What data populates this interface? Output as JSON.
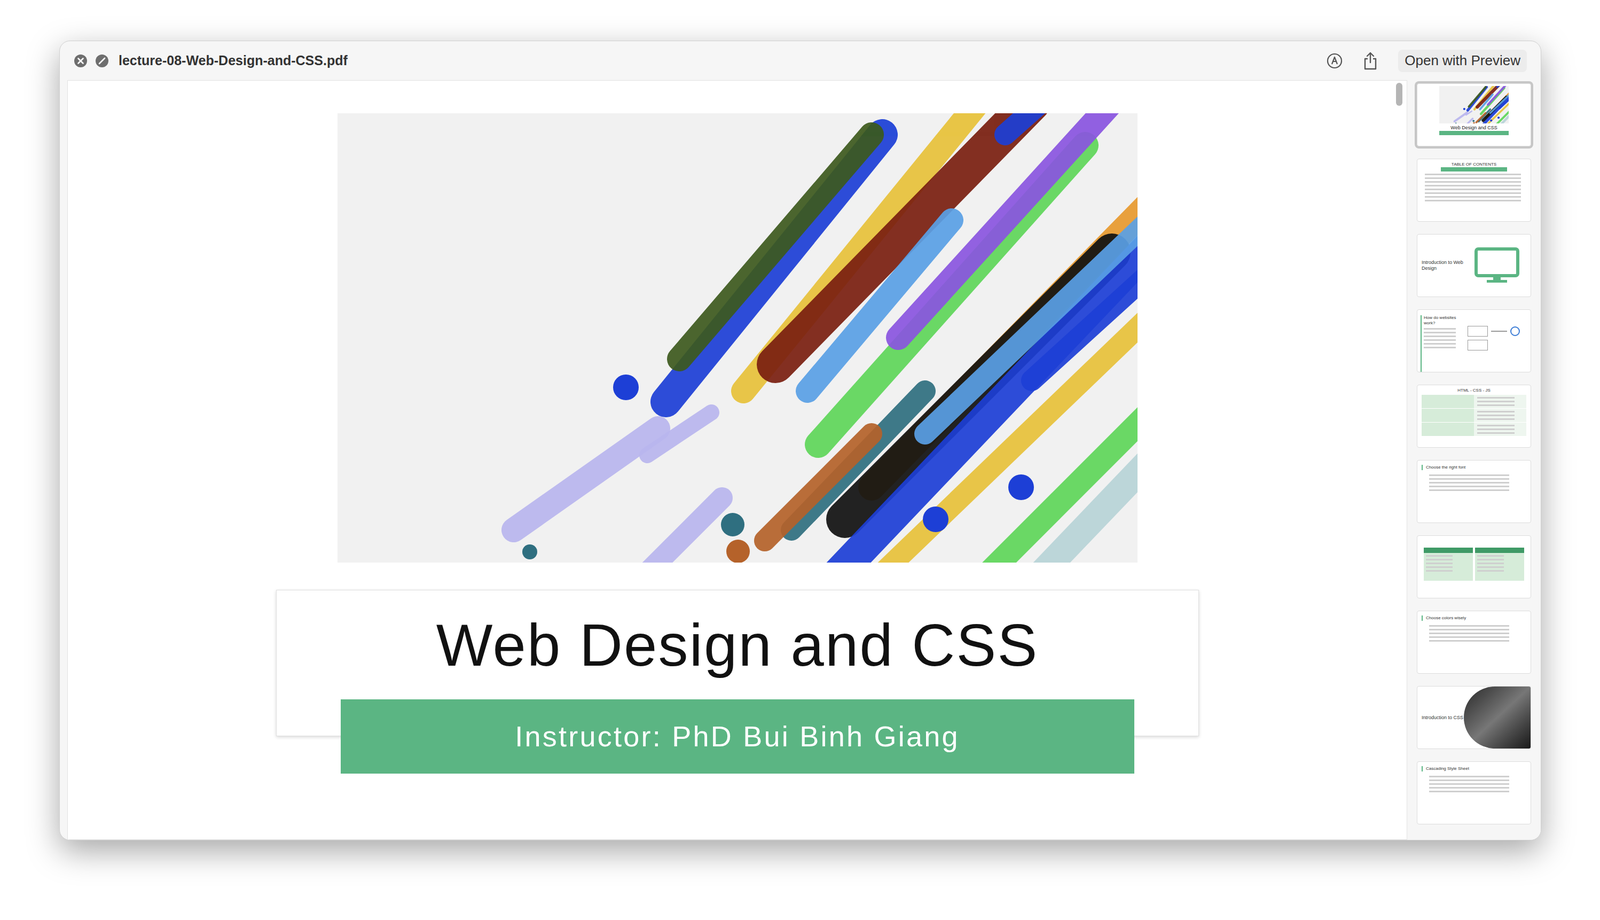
{
  "window": {
    "title": "lecture-08-Web-Design-and-CSS.pdf"
  },
  "toolbar": {
    "buttons": [
      "Open with Preview"
    ]
  },
  "page": {
    "title": "Web Design and CSS",
    "subtitle": "Instructor: PhD Bui Binh Giang"
  },
  "scrollbar": {
    "position": 0,
    "size": 0.03
  },
  "thumbnails": [
    {
      "kind": "cover",
      "title": "Web Design and CSS",
      "selected": true
    },
    {
      "kind": "toc",
      "title": "TABLE OF CONTENTS",
      "selected": false
    },
    {
      "kind": "section-monitor",
      "title": "Introduction to Web Design",
      "selected": false
    },
    {
      "kind": "diagram",
      "title": "How do websites work?",
      "selected": false
    },
    {
      "kind": "table",
      "title": "HTML - CSS - JS",
      "selected": false
    },
    {
      "kind": "bullets",
      "title": "Choose the right font",
      "selected": false
    },
    {
      "kind": "columns",
      "title": "",
      "selected": false
    },
    {
      "kind": "bullets",
      "title": "Choose colors wisely",
      "selected": false
    },
    {
      "kind": "section-photo",
      "title": "Introduction to CSS",
      "selected": false
    },
    {
      "kind": "bullets",
      "title": "Cascading Style Sheet",
      "selected": false
    }
  ]
}
